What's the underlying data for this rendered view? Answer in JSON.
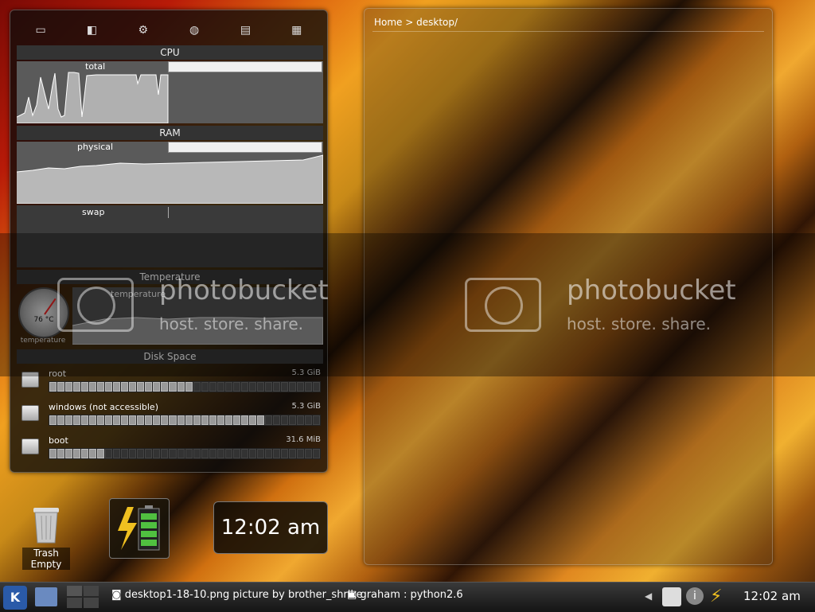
{
  "sysmon": {
    "toolbar_icons": [
      "network-icon",
      "hard-disk-icon",
      "devices-icon",
      "globe-icon",
      "battery-device-icon",
      "chip-icon"
    ],
    "cpu": {
      "header": "CPU",
      "label": "total"
    },
    "ram": {
      "header": "RAM",
      "physical_label": "physical",
      "swap_label": "swap"
    },
    "temperature": {
      "header": "Temperature",
      "graph_label": "temperature",
      "gauge_value": "76 °C",
      "gauge_label": "temperature"
    },
    "disk": {
      "header": "Disk Space",
      "items": [
        {
          "name": "root",
          "size": "5.3 GiB",
          "fill": 0.53
        },
        {
          "name": "windows (not accessible)",
          "size": "5.3 GiB",
          "fill": 0.79
        },
        {
          "name": "boot",
          "size": "31.6 MiB",
          "fill": 0.21
        }
      ]
    }
  },
  "folder": {
    "breadcrumb": "Home > desktop/"
  },
  "watermark": {
    "title": "photobucket",
    "subtitle": "host. store. share."
  },
  "desktop": {
    "trash_label_1": "Trash",
    "trash_label_2": "Empty",
    "clock": "12:02 am"
  },
  "taskbar": {
    "tasks": [
      {
        "label": "desktop1-18-10.png picture by brother_shrike"
      },
      {
        "label": "graham : python2.6"
      }
    ],
    "clock": "12:02 am"
  }
}
